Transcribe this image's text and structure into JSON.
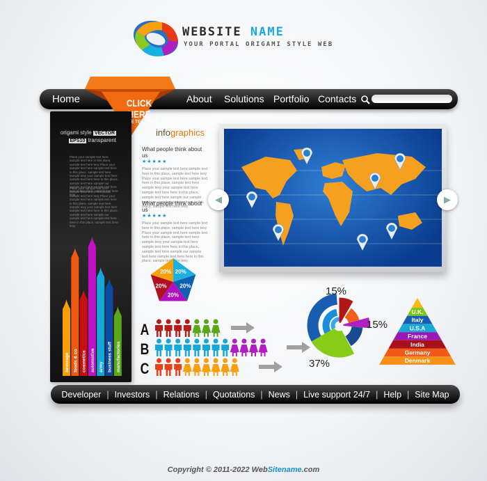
{
  "header": {
    "title_part1": "WEBSITE",
    "title_part2": "NAME",
    "tagline": "YOUR PORTAL ORIGAMI STYLE WEB"
  },
  "nav": {
    "items": [
      {
        "label": "Home"
      },
      {
        "label": "About"
      },
      {
        "label": "Solutions"
      },
      {
        "label": "Portfolio"
      },
      {
        "label": "Contacts"
      }
    ],
    "search_placeholder": ""
  },
  "cta": {
    "title": "CLICK HERE",
    "subtitle": "PLACE TEXT HERE",
    "color": "#f26a10"
  },
  "panel": {
    "line1": "origami style",
    "badge": "VECTOR",
    "badge2": "EPS10",
    "line2": "transparent",
    "para": "Place your sample text here sample text here in this place, sample text here texy Place your sample text here sample text here in this place, sample text here sample texy your sample text here sample text here here in this place, sample text here sample our sample text here sample text here here in this place, sample text here texy",
    "bars": [
      {
        "label": "beverage",
        "color": "#f7a000",
        "height": 0.55
      },
      {
        "label": "foods & co",
        "color": "#f05a10",
        "height": 0.92
      },
      {
        "label": "cosmetics",
        "color": "#c8100e",
        "height": 0.62
      },
      {
        "label": "automotive",
        "color": "#c010c8",
        "height": 1.0
      },
      {
        "label": "army",
        "color": "#14a8d8",
        "height": 0.78
      },
      {
        "label": "business stuff",
        "color": "#0a4aa0",
        "height": 0.7
      },
      {
        "label": "manufactories",
        "color": "#58a818",
        "height": 0.5
      }
    ]
  },
  "infographics": {
    "title_a": "info",
    "title_b": "graphics",
    "quotes": [
      {
        "heading": "What people think about us",
        "stars": "★★★★★",
        "body": "Place your sample text here sample text here in this place, sample text here texy Place your sample text here sample text here in this place, sample text here sample texy your sample text here sample text here here in this place, sample text here sample our sample text here sample text here here in this place, sample text here texy"
      },
      {
        "heading": "What people think about us",
        "stars": "★★★★★",
        "body": "Place your sample text here sample text here in this place, sample text here texy Place your sample text here sample text here in this place, sample text here sample texy your sample text here sample text here here in this place, sample text here sample our sample text here sample text here here in this place, sample text here texy"
      }
    ]
  },
  "slider": {
    "prev_icon": "chevron-left-icon",
    "next_icon": "chevron-right-icon"
  },
  "pentagon": {
    "segments": [
      {
        "label": "20%",
        "color": "#f7a010"
      },
      {
        "label": "20%",
        "color": "#1ab0e0"
      },
      {
        "label": "20%",
        "color": "#1060b0"
      },
      {
        "label": "20%",
        "color": "#b010c0"
      },
      {
        "label": "20%",
        "color": "#b01020"
      }
    ]
  },
  "people": {
    "rows": [
      {
        "letter": "A",
        "groups": [
          {
            "count": 4,
            "type": "male",
            "color": "#b51c1c"
          },
          {
            "count": 3,
            "type": "female",
            "color": "#5aa818"
          }
        ]
      },
      {
        "letter": "B",
        "groups": [
          {
            "count": 8,
            "type": "male",
            "color": "#18a8d8"
          },
          {
            "count": 4,
            "type": "female",
            "color": "#b020c0"
          }
        ]
      },
      {
        "letter": "C",
        "groups": [
          {
            "count": 3,
            "type": "male",
            "color": "#e8401a"
          },
          {
            "count": 6,
            "type": "female",
            "color": "#f8a010"
          }
        ]
      }
    ]
  },
  "donut": {
    "labels": [
      "15%",
      "15%",
      "37%"
    ]
  },
  "pyramid": {
    "levels": [
      {
        "label": "U.K.",
        "color": "#78c818"
      },
      {
        "label": "Italy",
        "color": "#1a5cb0"
      },
      {
        "label": "U.S.A",
        "color": "#18a8d8"
      },
      {
        "label": "France",
        "color": "#9a18b8"
      },
      {
        "label": "India",
        "color": "#a8101a"
      },
      {
        "label": "Germany",
        "color": "#f05a18"
      },
      {
        "label": "Denmark",
        "color": "#f89018"
      }
    ],
    "top_color": "#f8b818"
  },
  "footer": {
    "links": [
      {
        "label": "Developer"
      },
      {
        "label": "Investors"
      },
      {
        "label": "Relations"
      },
      {
        "label": "Quotations"
      },
      {
        "label": "News"
      },
      {
        "label": "Live support 24/7"
      },
      {
        "label": "Help"
      },
      {
        "label": "Site Map"
      }
    ],
    "separator": "|"
  },
  "copyright": {
    "prefix": "Copyright © 2011-2022  Web",
    "accent": "Sitename",
    "suffix": ".com"
  }
}
